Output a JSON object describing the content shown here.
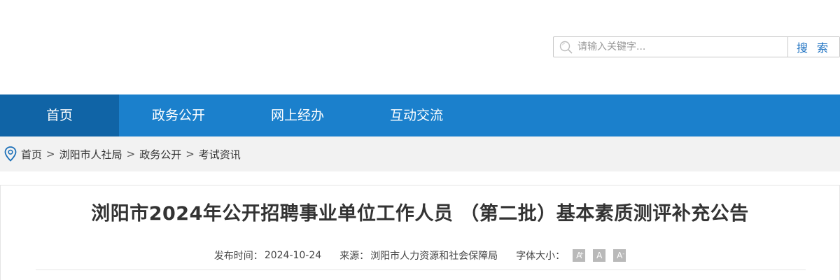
{
  "search": {
    "placeholder": "请输入关键字...",
    "button_label": "搜 索"
  },
  "nav": {
    "items": [
      {
        "label": "首页"
      },
      {
        "label": "政务公开"
      },
      {
        "label": "网上经办"
      },
      {
        "label": "互动交流"
      }
    ]
  },
  "breadcrumb": {
    "items": [
      "首页",
      "浏阳市人社局",
      "政务公开",
      "考试资讯"
    ],
    "separator": ">"
  },
  "article": {
    "title": "浏阳市2024年公开招聘事业单位工作人员 （第二批）基本素质测评补充公告",
    "publish_label": "发布时间：",
    "publish_date": "2024-10-24",
    "source_label": "来源：",
    "source_value": "浏阳市人力资源和社会保障局",
    "font_size_label": "字体大小：",
    "font_buttons": [
      "A",
      "A",
      "A"
    ]
  },
  "colors": {
    "nav_bg": "#1b80cc",
    "nav_active": "#1064a6",
    "search_button_text": "#1a6fc0"
  }
}
